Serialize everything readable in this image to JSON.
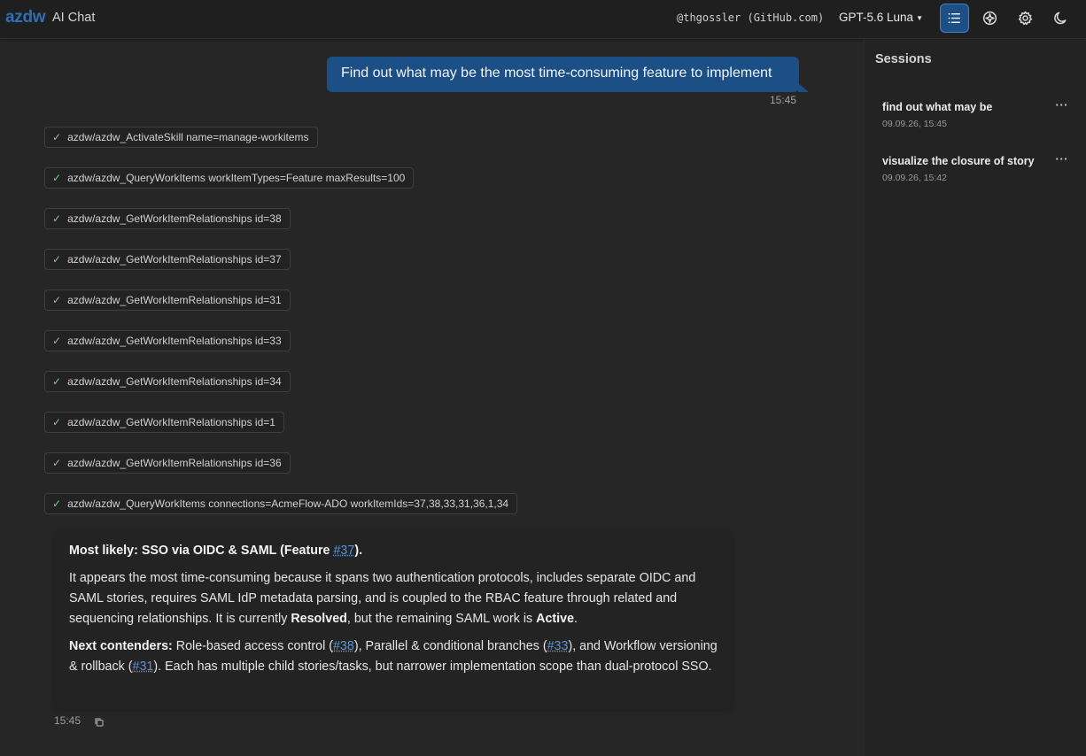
{
  "header": {
    "brand": "azdw",
    "app_title": "AI Chat",
    "user": "@thgossler (GitHub.com)",
    "model": "GPT-5.6 Luna",
    "accent_color": "#2f6fb3"
  },
  "sidebar": {
    "title": "Sessions",
    "sessions": [
      {
        "title": "find out what may be",
        "date": "09.09.26, 15:45"
      },
      {
        "title": "visualize the closure of story",
        "date": "09.09.26, 15:42"
      }
    ]
  },
  "chat": {
    "user_message": "Find out what may be the most time-consuming feature to implement",
    "user_time": "15:45",
    "tool_calls": [
      "azdw/azdw_ActivateSkill name=manage-workitems",
      "azdw/azdw_QueryWorkItems workItemTypes=Feature maxResults=100",
      "azdw/azdw_GetWorkItemRelationships id=38",
      "azdw/azdw_GetWorkItemRelationships id=37",
      "azdw/azdw_GetWorkItemRelationships id=31",
      "azdw/azdw_GetWorkItemRelationships id=33",
      "azdw/azdw_GetWorkItemRelationships id=34",
      "azdw/azdw_GetWorkItemRelationships id=1",
      "azdw/azdw_GetWorkItemRelationships id=36",
      "azdw/azdw_QueryWorkItems connections=AcmeFlow-ADO workItemIds=37,38,33,31,36,1,34"
    ],
    "answer": {
      "p1_label": "Most likely: SSO via OIDC & SAML (Feature ",
      "p1_link": "#37",
      "p1_end": ").",
      "p2_a": "It appears the most time-consuming because it spans two authentication protocols, includes separate OIDC and SAML stories, requires SAML IdP metadata parsing, and is coupled to the RBAC feature through related and sequencing relationships. It is currently ",
      "p2_resolved": "Resolved",
      "p2_b": ", but the remaining SAML work is ",
      "p2_active": "Active",
      "p2_c": ".",
      "p3_label": "Next contenders:",
      "p3_a": " Role-based access control (",
      "p3_link1": "#38",
      "p3_b": "), Parallel & conditional branches (",
      "p3_link2": "#33",
      "p3_c": "), and Workflow versioning & rollback (",
      "p3_link3": "#31",
      "p3_d": "). Each has multiple child stories/tasks, but narrower implementation scope than dual-protocol SSO."
    },
    "answer_time": "15:45"
  }
}
